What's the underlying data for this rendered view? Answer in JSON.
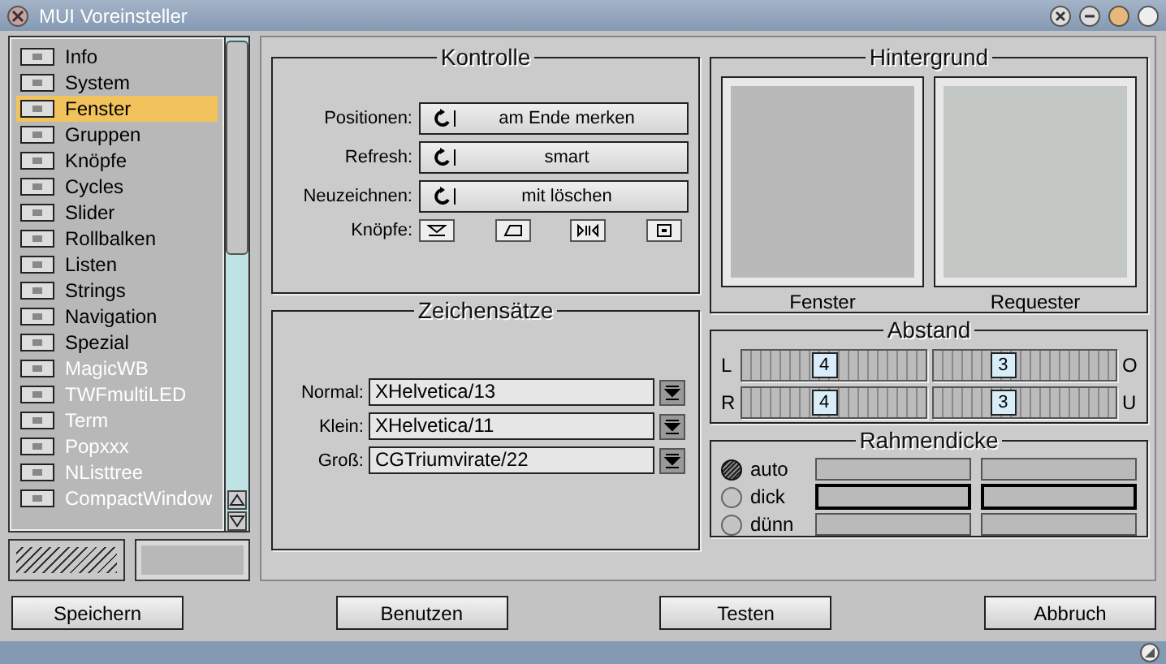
{
  "window": {
    "title": "MUI Voreinsteller"
  },
  "sidebar": {
    "items": [
      {
        "label": "Info",
        "selected": false,
        "disabled": false
      },
      {
        "label": "System",
        "selected": false,
        "disabled": false
      },
      {
        "label": "Fenster",
        "selected": true,
        "disabled": false
      },
      {
        "label": "Gruppen",
        "selected": false,
        "disabled": false
      },
      {
        "label": "Knöpfe",
        "selected": false,
        "disabled": false
      },
      {
        "label": "Cycles",
        "selected": false,
        "disabled": false
      },
      {
        "label": "Slider",
        "selected": false,
        "disabled": false
      },
      {
        "label": "Rollbalken",
        "selected": false,
        "disabled": false
      },
      {
        "label": "Listen",
        "selected": false,
        "disabled": false
      },
      {
        "label": "Strings",
        "selected": false,
        "disabled": false
      },
      {
        "label": "Navigation",
        "selected": false,
        "disabled": false
      },
      {
        "label": "Spezial",
        "selected": false,
        "disabled": false
      },
      {
        "label": "MagicWB",
        "selected": false,
        "disabled": true
      },
      {
        "label": "TWFmultiLED",
        "selected": false,
        "disabled": true
      },
      {
        "label": "Term",
        "selected": false,
        "disabled": true
      },
      {
        "label": "Popxxx",
        "selected": false,
        "disabled": true
      },
      {
        "label": "NListtree",
        "selected": false,
        "disabled": true
      },
      {
        "label": "CompactWindow",
        "selected": false,
        "disabled": true
      }
    ]
  },
  "kontrolle": {
    "title": "Kontrolle",
    "cycles": [
      {
        "label": "Positionen:",
        "value": "am Ende merken"
      },
      {
        "label": "Refresh:",
        "value": "smart"
      },
      {
        "label": "Neuzeichnen:",
        "value": "mit löschen"
      }
    ],
    "buttons_label": "Knöpfe:"
  },
  "zeichensaetze": {
    "title": "Zeichensätze",
    "fonts": [
      {
        "label": "Normal:",
        "value": "XHelvetica/13"
      },
      {
        "label": "Klein:",
        "value": "XHelvetica/11"
      },
      {
        "label": "Groß:",
        "value": "CGTriumvirate/22"
      }
    ]
  },
  "hintergrund": {
    "title": "Hintergrund",
    "swatches": [
      {
        "label": "Fenster",
        "color": "#b9b9b9"
      },
      {
        "label": "Requester",
        "color": "#c4c8c4"
      }
    ]
  },
  "abstand": {
    "title": "Abstand",
    "rows": [
      {
        "left_label": "L",
        "sliders": [
          {
            "value": "4",
            "level": 0.44
          },
          {
            "value": "3",
            "level": 0.375
          }
        ],
        "right_label": "O"
      },
      {
        "left_label": "R",
        "sliders": [
          {
            "value": "4",
            "level": 0.44
          },
          {
            "value": "3",
            "level": 0.375
          }
        ],
        "right_label": "U"
      }
    ]
  },
  "rahmendicke": {
    "title": "Rahmendicke",
    "options": [
      {
        "label": "auto",
        "selected": true
      },
      {
        "label": "dick",
        "selected": false
      },
      {
        "label": "dünn",
        "selected": false
      }
    ]
  },
  "buttons": [
    "Speichern",
    "Benutzen",
    "Testen",
    "Abbruch"
  ]
}
